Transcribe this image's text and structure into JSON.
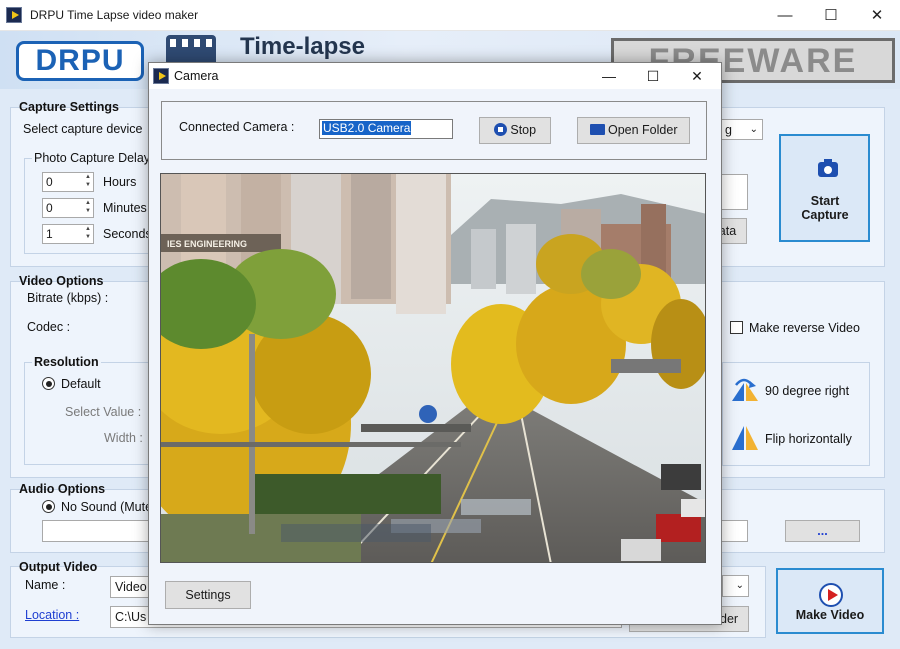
{
  "window": {
    "title": "DRPU Time Lapse video maker",
    "minimize": "—",
    "maximize": "☐",
    "close": "✕"
  },
  "banner": {
    "logo": "DRPU",
    "app_title": "Time-lapse",
    "freeware": "FREEWARE"
  },
  "capture_settings": {
    "title": "Capture Settings",
    "select_device_label": "Select capture device",
    "photo_delay_title": "Photo Capture Delay",
    "hours_value": "0",
    "hours_label": "Hours",
    "minutes_value": "0",
    "minutes_label": "Minutes",
    "seconds_value": "1",
    "seconds_label": "Seconds",
    "dropdown_partial": "g",
    "data_button_partial": "ata",
    "start_capture_label": "Start Capture",
    "start_capture_icon": "camera-icon"
  },
  "video_options": {
    "title": "Video Options",
    "bitrate_label": "Bitrate (kbps) :",
    "codec_label": "Codec :",
    "resolution_title": "Resolution",
    "default_label": "Default",
    "select_value_label": "Select Value :",
    "width_label": "Width :",
    "make_reverse_label": "Make reverse Video",
    "rotate_label": "90 degree right",
    "flip_label": "Flip horizontally"
  },
  "audio_options": {
    "title": "Audio Options",
    "no_sound_label": "No Sound (Mute)",
    "browse_label": "..."
  },
  "output_video": {
    "title": "Output Video",
    "name_label": "Name :",
    "name_value": "Video",
    "location_label": "Location :",
    "location_value": "C:\\Us",
    "folder_button_partial": "der",
    "make_video_label": "Make Video",
    "make_video_icon": "play-icon"
  },
  "camera_dialog": {
    "title": "Camera",
    "minimize": "—",
    "maximize": "☐",
    "close": "✕",
    "connected_label": "Connected Camera :",
    "camera_value": "USB2.0 Camera",
    "stop_label": "Stop",
    "open_folder_label": "Open Folder",
    "settings_label": "Settings",
    "preview_sign": "IES ENGINEERING"
  },
  "colors": {
    "accent": "#2a8bd0",
    "panel": "#eef4fc",
    "selection": "#1764c8"
  }
}
